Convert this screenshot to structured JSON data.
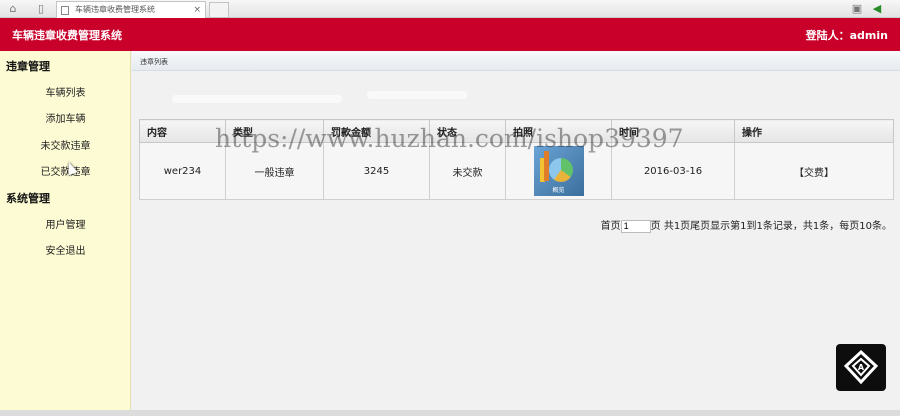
{
  "browser": {
    "tab_title": "车辆违章收费管理系统",
    "tab_close": "×"
  },
  "header": {
    "app_title": "车辆违章收费管理系统",
    "login_text": "登陆人：admin"
  },
  "sidebar": {
    "groups": [
      {
        "title": "违章管理",
        "items": [
          {
            "label": "车辆列表"
          },
          {
            "label": "添加车辆"
          },
          {
            "label": "未交款违章"
          },
          {
            "label": "已交款违章"
          }
        ]
      },
      {
        "title": "系统管理",
        "items": [
          {
            "label": "用户管理"
          },
          {
            "label": "安全退出"
          }
        ]
      }
    ]
  },
  "main": {
    "breadcrumb": "违章列表",
    "table": {
      "headers": [
        "内容",
        "类型",
        "罚款金额",
        "状态",
        "拍照",
        "时间",
        "操作"
      ],
      "rows": [
        {
          "content": "wer234",
          "type": "一般违章",
          "amount": "3245",
          "status": "未交款",
          "photo_label": "概览",
          "time": "2016-03-16",
          "action": "【交费】"
        }
      ]
    },
    "pager": {
      "first": "首页",
      "page_value": "1",
      "text": "页 共1页尾页显示第1到1条记录，共1条，每页10条。"
    }
  },
  "watermark": "https://www.huzhan.com/ishop39397",
  "colors": {
    "header_bg": "#c8002a",
    "sidebar_bg": "#fdfbd3"
  }
}
